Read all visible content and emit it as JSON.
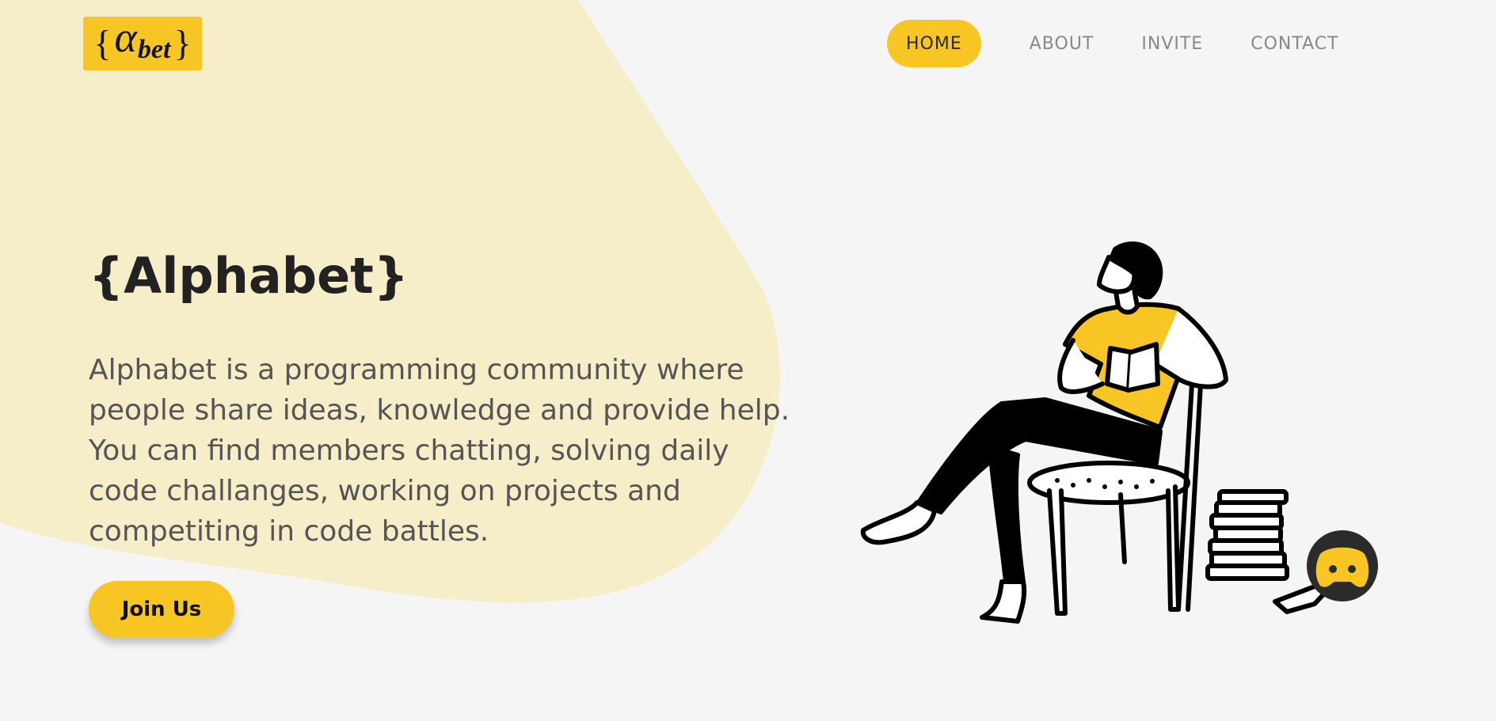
{
  "colors": {
    "accent": "#f7c625",
    "blob": "#f6edc9",
    "background": "#f5f5f5",
    "heading": "#222222",
    "body_text": "#555555",
    "nav_text": "#888888"
  },
  "logo": {
    "open_brace": "{",
    "alpha": "α",
    "bet": "bet",
    "close_brace": "}"
  },
  "nav": {
    "items": [
      {
        "label": "HOME",
        "active": true
      },
      {
        "label": "ABOUT",
        "active": false
      },
      {
        "label": "INVITE",
        "active": false
      },
      {
        "label": "CONTACT",
        "active": false
      }
    ]
  },
  "hero": {
    "title": "{Alphabet}",
    "description_lines": [
      "Alphabet is a programming community where",
      "people share ideas, knowledge and provide help.",
      "You can find members chatting, solving daily",
      "code challanges, working on projects and",
      "competiting in code battles."
    ],
    "cta_label": "Join Us"
  },
  "illustration": {
    "icon_names": [
      "person-reading-icon",
      "chair-icon",
      "books-stack-icon",
      "discord-icon",
      "phone-icon"
    ]
  }
}
